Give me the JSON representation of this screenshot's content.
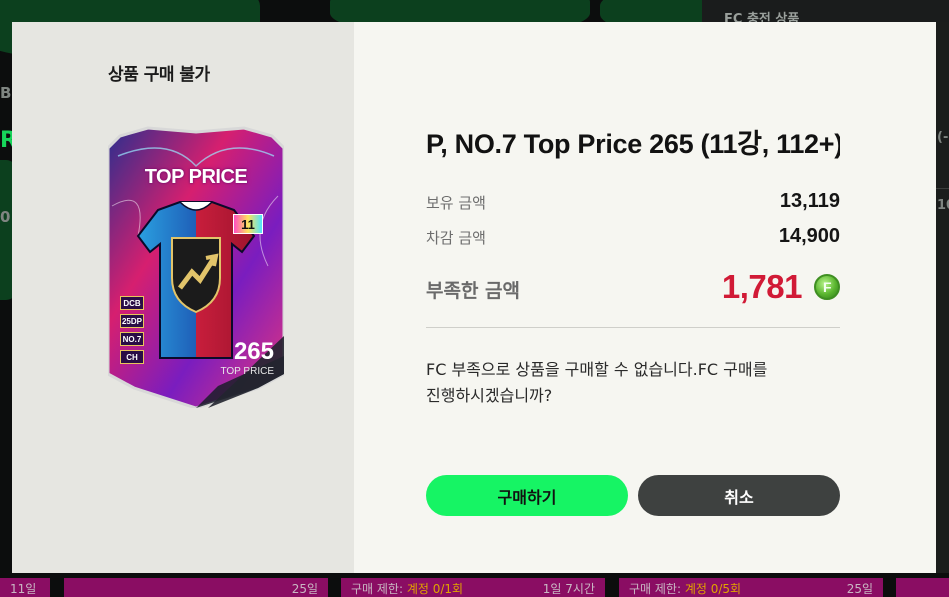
{
  "background": {
    "top_right_label": "FC 충전 상품",
    "edge_texts": [
      "B",
      "R",
      "0 ",
      "(-",
      "10"
    ],
    "bottom_cells": [
      {
        "left": "11일",
        "right": "",
        "warn": ""
      },
      {
        "left": "",
        "right": "25일",
        "warn": ""
      },
      {
        "left": "구매 제한: ",
        "warn": "계정 0/1회",
        "right": "1일 7시간"
      },
      {
        "left": "구매 제한: ",
        "warn": "계정 0/5회",
        "right": "25일"
      }
    ]
  },
  "modal": {
    "title": "상품 구매 불가",
    "card": {
      "title": "TOP PRICE",
      "ovr": "265",
      "sub": "TOP PRICE",
      "number": "11",
      "badges": [
        "DCB",
        "25DP",
        "NO.7",
        "CH"
      ]
    },
    "product_name": "P, NO.7 Top Price 265 (11강, 112+)",
    "owned_label": "보유 금액",
    "owned_value": "13,119",
    "deduct_label": "차감 금액",
    "deduct_value": "14,900",
    "shortage_label": "부족한 금액",
    "shortage_value": "1,781",
    "coin_symbol": "F",
    "message_line1": "FC 부족으로 상품을 구매할 수 없습니다.FC 구매를",
    "message_line2": "진행하시겠습니까?",
    "buy_button": "구매하기",
    "cancel_button": "취소"
  },
  "colors": {
    "accent_green": "#16f464",
    "shortage_red": "#d11a36",
    "cancel_gray": "#3e4140"
  }
}
